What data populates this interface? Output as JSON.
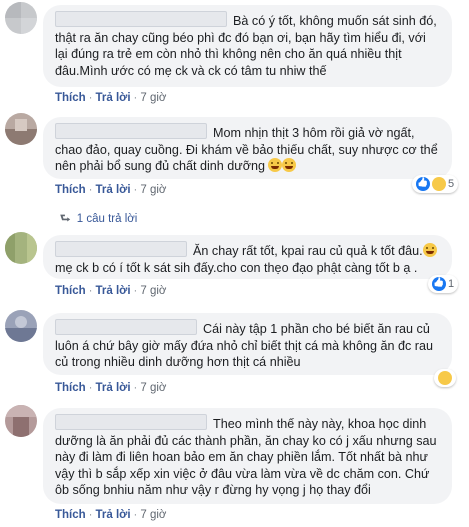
{
  "comments": [
    {
      "text": "Bà có ý tốt, không muốn sát sinh đó, thật ra ăn chay cũng béo phì đc đó bạn ơi, bạn hãy tìm hiểu đi, với lại đúng ra trẻ em còn nhỏ thì không nên cho ăn quá nhiều thịt đâu.Mình ước có mẹ ck và ck có tâm tu nhiw thế",
      "like": "Thích",
      "reply": "Trả lời",
      "time": "7 giờ"
    },
    {
      "text": "Mom nhịn thịt 3 hôm rồi giả vờ ngất, chao đảo, quay cuồng. Đi khám về bảo thiếu chất, suy nhược cơ thể nên phải bổ sung đủ chất dinh dưỡng",
      "like": "Thích",
      "reply": "Trả lời",
      "time": "7 giờ",
      "reaction_count": "5",
      "reply_toggle": "1 câu trả lời"
    },
    {
      "text": "Ăn chay rất tốt, kpai rau củ quả k tốt đâu.",
      "text2": " mẹ ck b có í tốt k sát sih đấy.cho con thẹo đạo phật càng tốt b ạ .",
      "like": "Thích",
      "reply": "Trả lời",
      "time": "7 giờ",
      "reaction_count": "1"
    },
    {
      "text": "Cái này tập 1 phần cho bé biết ăn rau củ luôn á chứ bây giờ mấy đứa nhỏ chỉ biết thịt cá mà không ăn đc rau củ trong nhiều dinh dưỡng hơn thịt cá nhiều",
      "like": "Thích",
      "reply": "Trả lời",
      "time": "7 giờ"
    },
    {
      "text": "Theo mình thế này này, khoa học dinh dưỡng là ăn phải đủ các thành phần, ăn chay ko có j xấu nhưng sau này đi làm đi liên hoan bảo em ăn chay phiền lắm. Tốt nhất bà như vậy thì b sắp xếp xin việc ở đâu vừa làm vừa về dc chăm con. Chứ ôb sống bnhiu năm như vậy r đừng hy vọng j họ thay đổi",
      "like": "Thích",
      "reply": "Trả lời",
      "time": "7 giờ"
    }
  ],
  "colors": {
    "link": "#385898",
    "bubble": "#f2f3f5",
    "meta": "#606770",
    "like_blue": "#1877f2"
  }
}
